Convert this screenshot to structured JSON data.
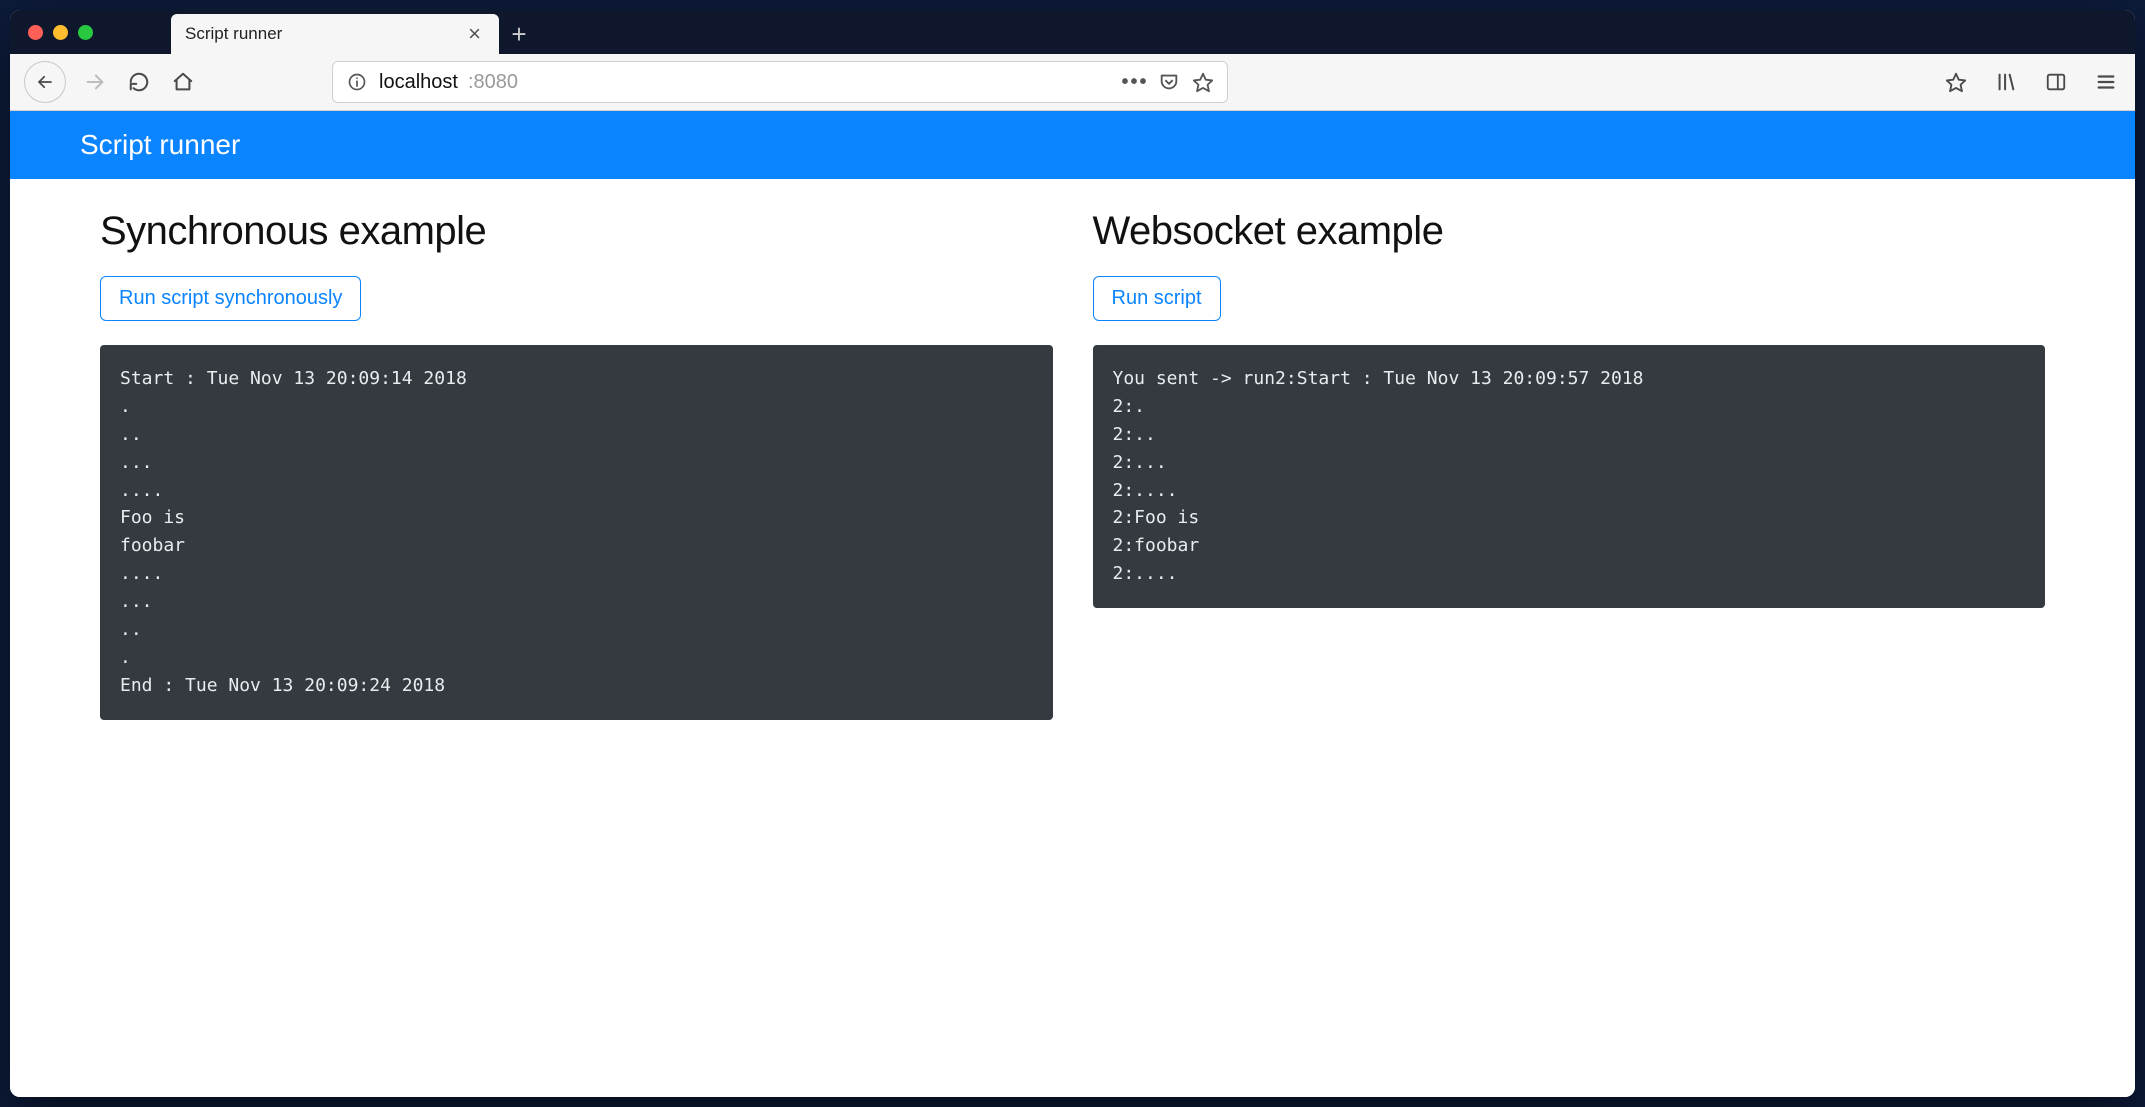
{
  "browser": {
    "tab_title": "Script runner",
    "url_host": "localhost",
    "url_port": ":8080"
  },
  "app": {
    "banner_title": "Script runner",
    "left": {
      "heading": "Synchronous example",
      "button_label": "Run script synchronously",
      "output_lines": [
        "Start : Tue Nov 13 20:09:14 2018",
        ".",
        "..",
        "...",
        "....",
        "Foo is",
        "foobar",
        "....",
        "...",
        "..",
        ".",
        "End : Tue Nov 13 20:09:24 2018"
      ]
    },
    "right": {
      "heading": "Websocket example",
      "button_label": "Run script",
      "output_lines": [
        "You sent -> run2:Start : Tue Nov 13 20:09:57 2018",
        "2:.",
        "2:..",
        "2:...",
        "2:....",
        "2:Foo is",
        "2:foobar",
        "2:...."
      ]
    }
  }
}
